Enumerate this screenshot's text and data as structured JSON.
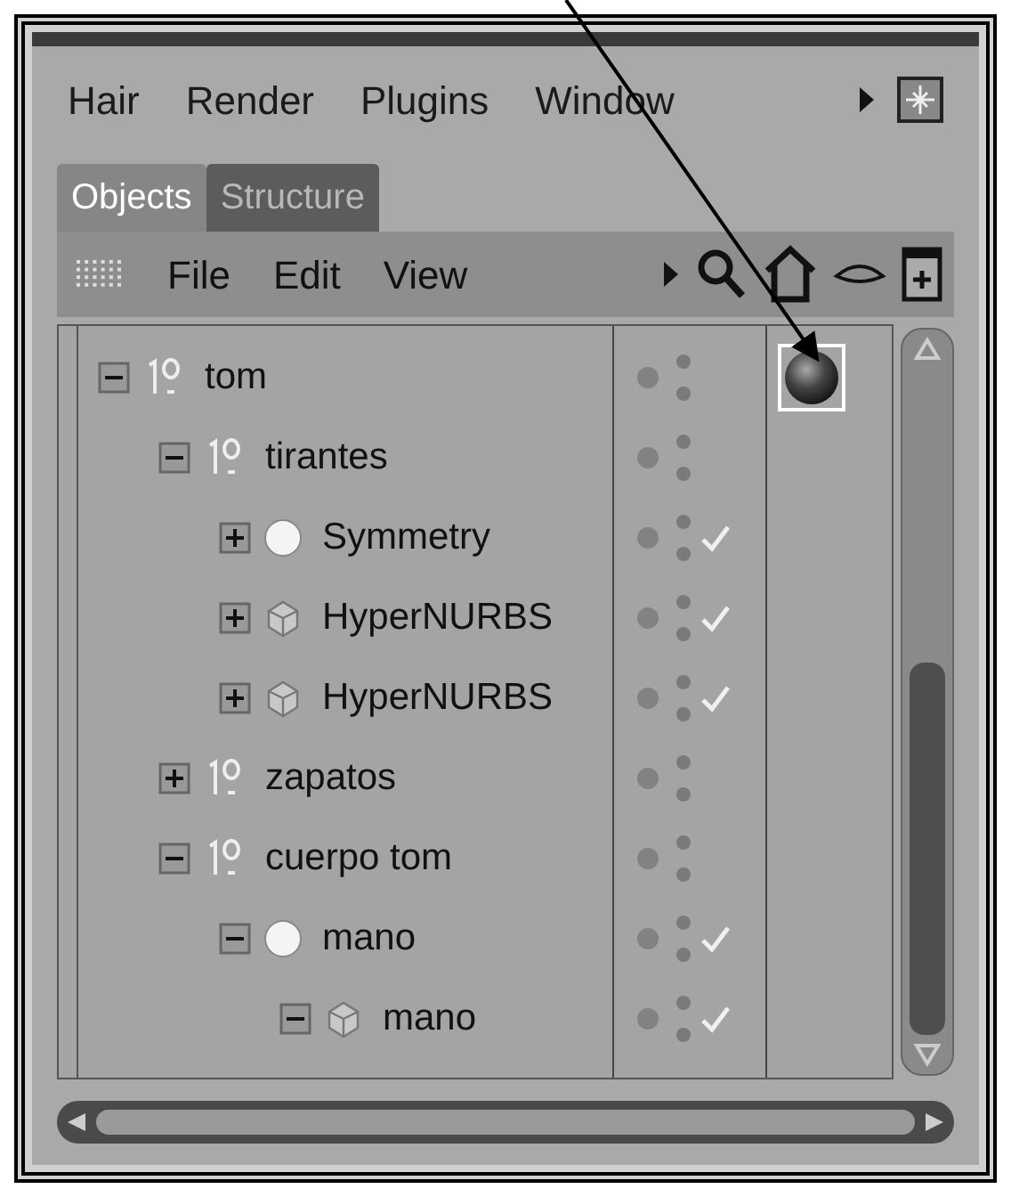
{
  "menu": [
    "Hair",
    "Render",
    "Plugins",
    "Window"
  ],
  "tabs": [
    {
      "label": "Objects",
      "selected": true
    },
    {
      "label": "Structure",
      "selected": false
    }
  ],
  "toolbar_menu": [
    "File",
    "Edit",
    "View"
  ],
  "objects": [
    {
      "name": "tom",
      "kind": "null",
      "expanded": true,
      "checked": false,
      "tag": {
        "kind": "material",
        "selected": true
      },
      "children": [
        {
          "name": "tirantes",
          "kind": "null",
          "expanded": true,
          "checked": false,
          "children": [
            {
              "name": "Symmetry",
              "kind": "symmetry",
              "expanded": false,
              "checked": true
            },
            {
              "name": "HyperNURBS",
              "kind": "hypernurbs",
              "expanded": false,
              "checked": true
            },
            {
              "name": "HyperNURBS",
              "kind": "hypernurbs",
              "expanded": false,
              "checked": true
            }
          ]
        },
        {
          "name": "zapatos",
          "kind": "null",
          "expanded": false,
          "checked": false
        },
        {
          "name": "cuerpo tom",
          "kind": "null",
          "expanded": true,
          "checked": false,
          "children": [
            {
              "name": "mano",
              "kind": "symmetry",
              "expanded": true,
              "checked": true,
              "children": [
                {
                  "name": "mano",
                  "kind": "hypernurbs",
                  "expanded": true,
                  "checked": true
                }
              ]
            }
          ]
        }
      ]
    }
  ]
}
